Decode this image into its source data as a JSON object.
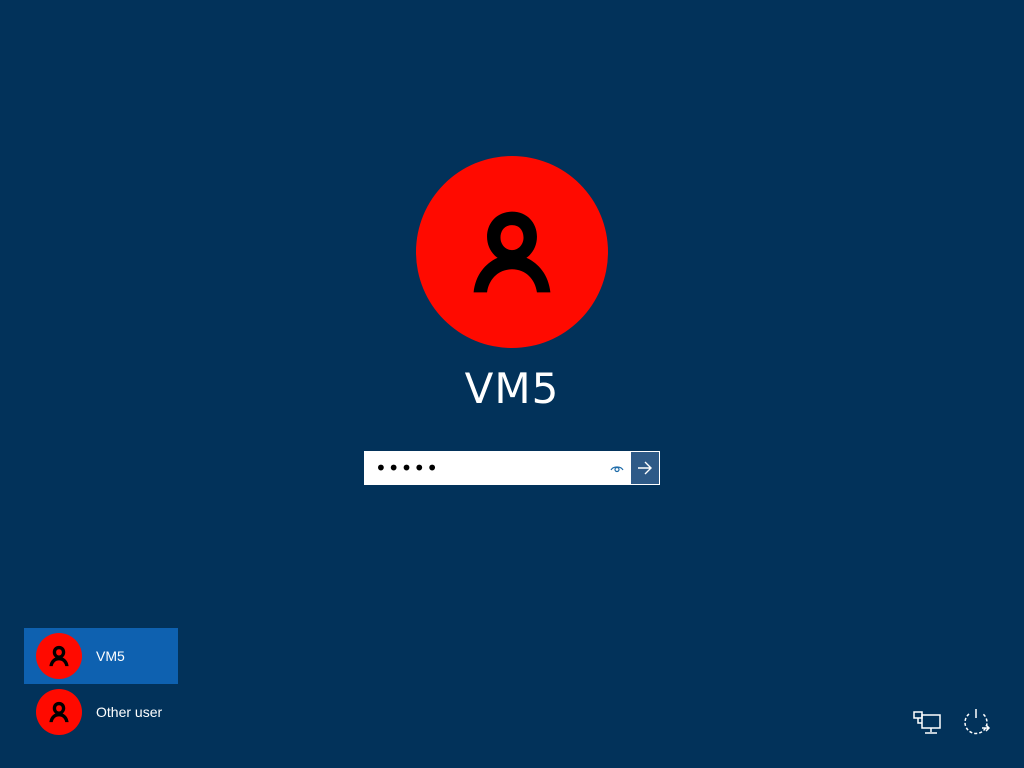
{
  "user": {
    "name": "VM5",
    "avatar_icon": "user-avatar-icon"
  },
  "password": {
    "value": "•••••",
    "reveal_icon": "eye-icon",
    "submit_icon": "arrow-right-icon"
  },
  "user_list": [
    {
      "label": "VM5",
      "selected": true,
      "icon": "user-avatar-icon"
    },
    {
      "label": "Other user",
      "selected": false,
      "icon": "user-avatar-icon"
    }
  ],
  "corner": {
    "network_icon": "network-icon",
    "power_icon": "power-icon"
  },
  "colors": {
    "background": "#02325a",
    "avatar": "#ff0a00",
    "selected_tile": "#0e61b0",
    "submit_button": "#2e5a87"
  }
}
